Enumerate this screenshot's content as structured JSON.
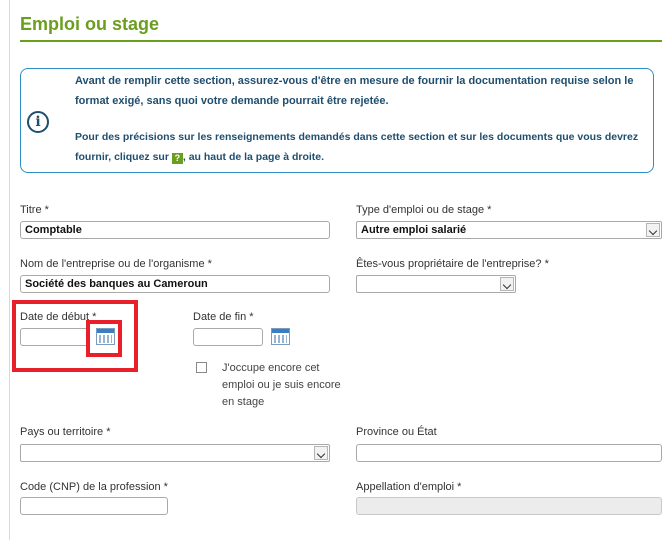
{
  "section": {
    "title": "Emploi ou stage"
  },
  "info": {
    "icon": "info-icon",
    "paragraph1": "Avant de remplir cette section, assurez-vous d'être en mesure de fournir la documentation requise selon le format exigé, sans quoi votre demande pourrait être rejetée.",
    "paragraph2_before": "Pour des précisions sur les renseignements demandés dans cette section et sur les documents que vous devrez fournir, cliquez sur ",
    "help_badge": "?",
    "paragraph2_after": ", au haut de la page à droite."
  },
  "fields": {
    "titre": {
      "label": "Titre *",
      "value": "Comptable"
    },
    "type_emploi": {
      "label": "Type d'emploi ou de stage *",
      "value": "Autre emploi salarié"
    },
    "entreprise": {
      "label": "Nom de l'entreprise ou de l'organisme *",
      "value": "Société des banques au Cameroun"
    },
    "proprietaire": {
      "label": "Êtes-vous propriétaire de l'entreprise? *",
      "value": ""
    },
    "date_debut": {
      "label": "Date de début *",
      "value": ""
    },
    "date_fin": {
      "label": "Date de fin *",
      "value": ""
    },
    "encore": {
      "label": "J'occupe encore cet emploi ou je suis encore en stage",
      "checked": false
    },
    "pays": {
      "label": "Pays ou territoire *",
      "value": ""
    },
    "province": {
      "label": "Province ou État",
      "value": ""
    },
    "cnp": {
      "label": "Code (CNP) de la profession *",
      "value": ""
    },
    "appellation": {
      "label": "Appellation d'emploi *",
      "value": ""
    }
  },
  "colors": {
    "accent": "#6b9e1f",
    "info_border": "#2e8fc4",
    "info_text": "#1f4e6e",
    "highlight": "#e8202a"
  }
}
